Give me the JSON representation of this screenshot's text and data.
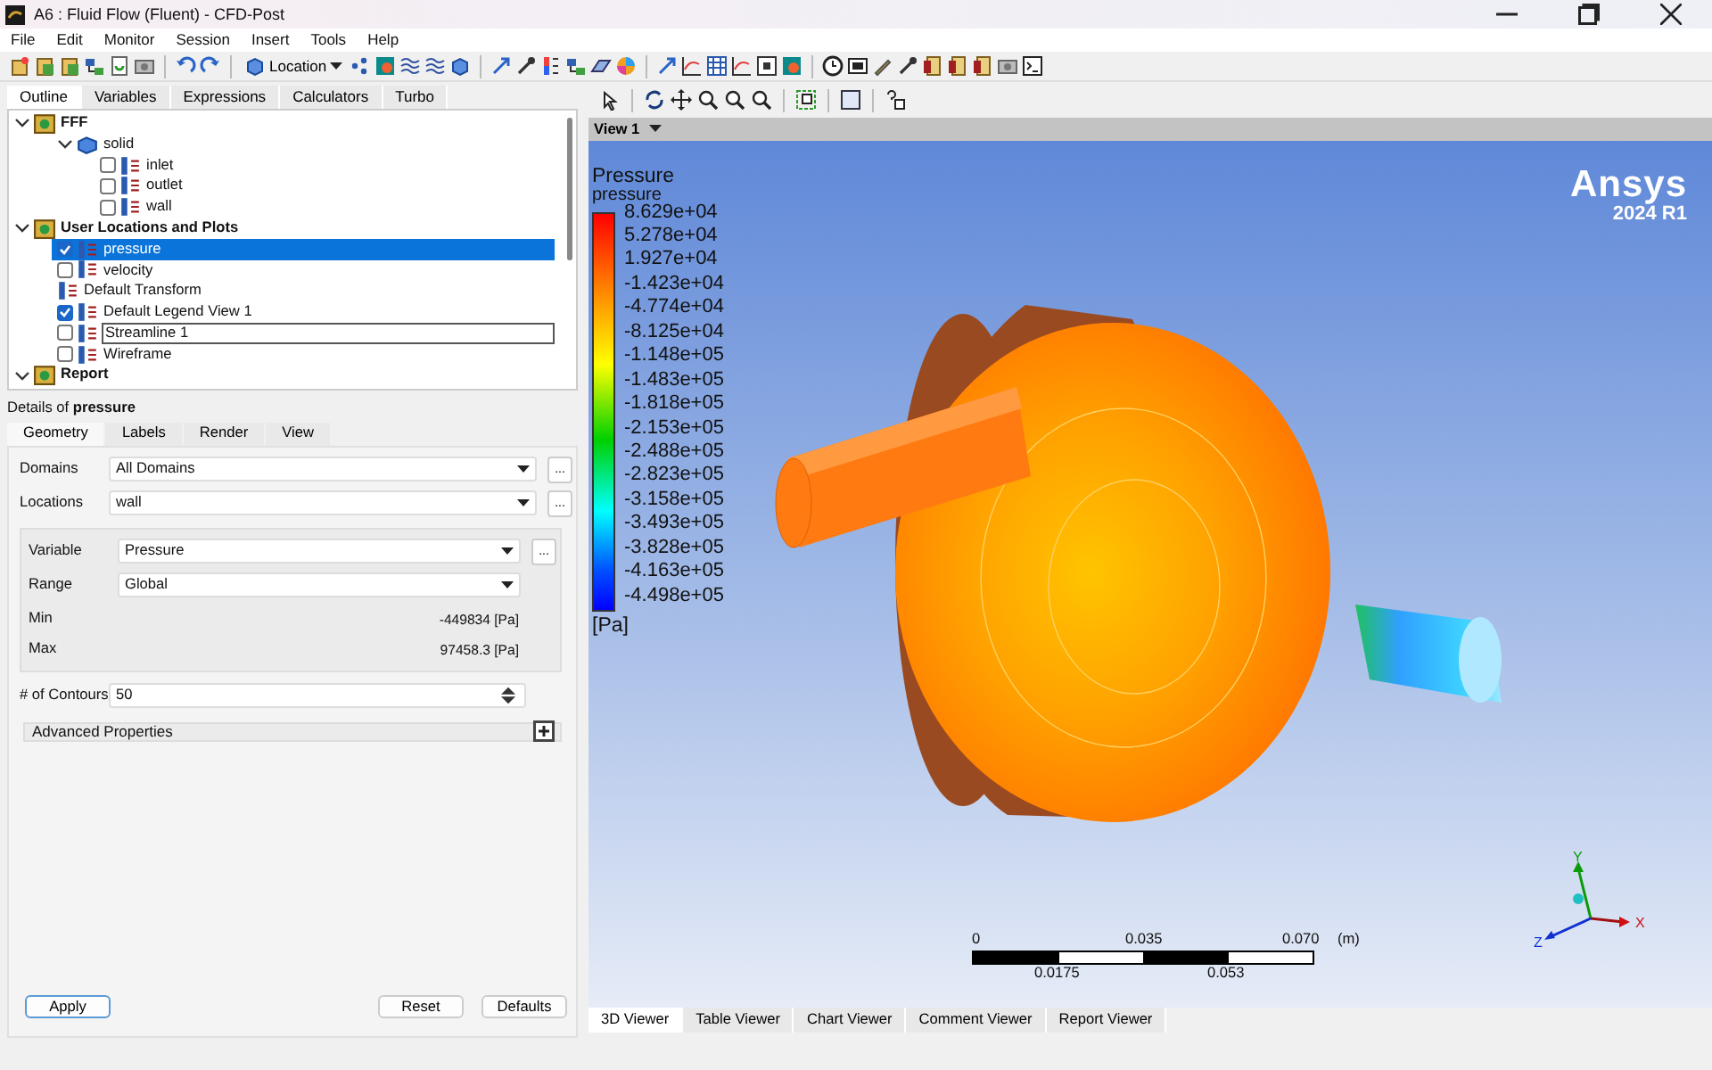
{
  "window": {
    "title": "A6 : Fluid Flow (Fluent) - CFD-Post"
  },
  "menu": [
    "File",
    "Edit",
    "Monitor",
    "Session",
    "Insert",
    "Tools",
    "Help"
  ],
  "toolbar": {
    "location_button": "Location"
  },
  "outline_tabs": [
    {
      "label": "Outline",
      "selected": true
    },
    {
      "label": "Variables",
      "selected": false
    },
    {
      "label": "Expressions",
      "selected": false
    },
    {
      "label": "Calculators",
      "selected": false
    },
    {
      "label": "Turbo",
      "selected": false
    }
  ],
  "tree": [
    {
      "label": "FFF",
      "kind": "group",
      "bold": true,
      "expanded": true,
      "children": [
        {
          "label": "solid",
          "kind": "group",
          "bold": false,
          "expanded": true,
          "children": [
            {
              "label": "inlet",
              "kind": "checkbox",
              "checked": false,
              "selected": false
            },
            {
              "label": "outlet",
              "kind": "checkbox",
              "checked": false,
              "selected": false
            },
            {
              "label": "wall",
              "kind": "checkbox",
              "checked": false,
              "selected": false
            }
          ]
        }
      ]
    },
    {
      "label": "User Locations and Plots",
      "kind": "group",
      "bold": true,
      "expanded": true,
      "children": [
        {
          "label": "pressure",
          "kind": "checkbox",
          "checked": true,
          "selected": true,
          "renaming": false
        },
        {
          "label": "velocity",
          "kind": "checkbox",
          "checked": false,
          "selected": false,
          "renaming": false
        },
        {
          "label": "Default Transform",
          "kind": "plain",
          "selected": false
        },
        {
          "label": "Default Legend View 1",
          "kind": "checkbox",
          "checked": true,
          "selected": false,
          "renaming": false
        },
        {
          "label": "Streamline 1",
          "kind": "checkbox",
          "checked": false,
          "selected": false,
          "renaming": true
        },
        {
          "label": "Wireframe",
          "kind": "checkbox",
          "checked": false,
          "selected": false,
          "renaming": false
        }
      ]
    },
    {
      "label": "Report",
      "kind": "group",
      "bold": true,
      "expanded": true
    }
  ],
  "details": {
    "heading": "Details of **pressure**",
    "tabs": [
      {
        "label": "Geometry",
        "selected": true
      },
      {
        "label": "Labels",
        "selected": false
      },
      {
        "label": "Render",
        "selected": false
      },
      {
        "label": "View",
        "selected": false
      }
    ],
    "domains": {
      "label": "Domains",
      "value": "All Domains",
      "more": "..."
    },
    "locations": {
      "label": "Locations",
      "value": "wall",
      "more": "..."
    },
    "variable": {
      "label": "Variable",
      "value": "Pressure",
      "more": "..."
    },
    "range": {
      "label": "Range",
      "value": "Global"
    },
    "min": {
      "label": "Min",
      "value": "-449834 [Pa]"
    },
    "max": {
      "label": "Max",
      "value": "97458.3 [Pa]"
    },
    "contours": {
      "label": "# of Contours",
      "value": "50"
    },
    "advanced": {
      "label": "Advanced Properties",
      "expanded": false
    }
  },
  "buttons": {
    "apply": "Apply",
    "reset": "Reset",
    "defaults": "Defaults"
  },
  "viewer": {
    "view_label": "View 1",
    "legend": {
      "title": "Pressure",
      "subtitle": "pressure",
      "unit": "[Pa]",
      "labels": [
        "8.629e+04",
        "5.278e+04",
        "1.927e+04",
        "-1.423e+04",
        "-4.774e+04",
        "-8.125e+04",
        "-1.148e+05",
        "-1.483e+05",
        "-1.818e+05",
        "-2.153e+05",
        "-2.488e+05",
        "-2.823e+05",
        "-3.158e+05",
        "-3.493e+05",
        "-3.828e+05",
        "-4.163e+05",
        "-4.498e+05"
      ]
    },
    "logo": {
      "name": "Ansys",
      "version": "2024 R1"
    },
    "scale": {
      "top_labels": [
        "0",
        "0.035",
        "0.070"
      ],
      "unit": "(m)",
      "bottom_labels": [
        "0.0175",
        "0.053"
      ]
    },
    "axes": {
      "x": "X",
      "y": "Y",
      "z": "Z"
    }
  },
  "viewer_tabs": [
    {
      "label": "3D Viewer",
      "selected": true
    },
    {
      "label": "Table Viewer",
      "selected": false
    },
    {
      "label": "Chart Viewer",
      "selected": false
    },
    {
      "label": "Comment Viewer",
      "selected": false
    },
    {
      "label": "Report Viewer",
      "selected": false
    }
  ]
}
